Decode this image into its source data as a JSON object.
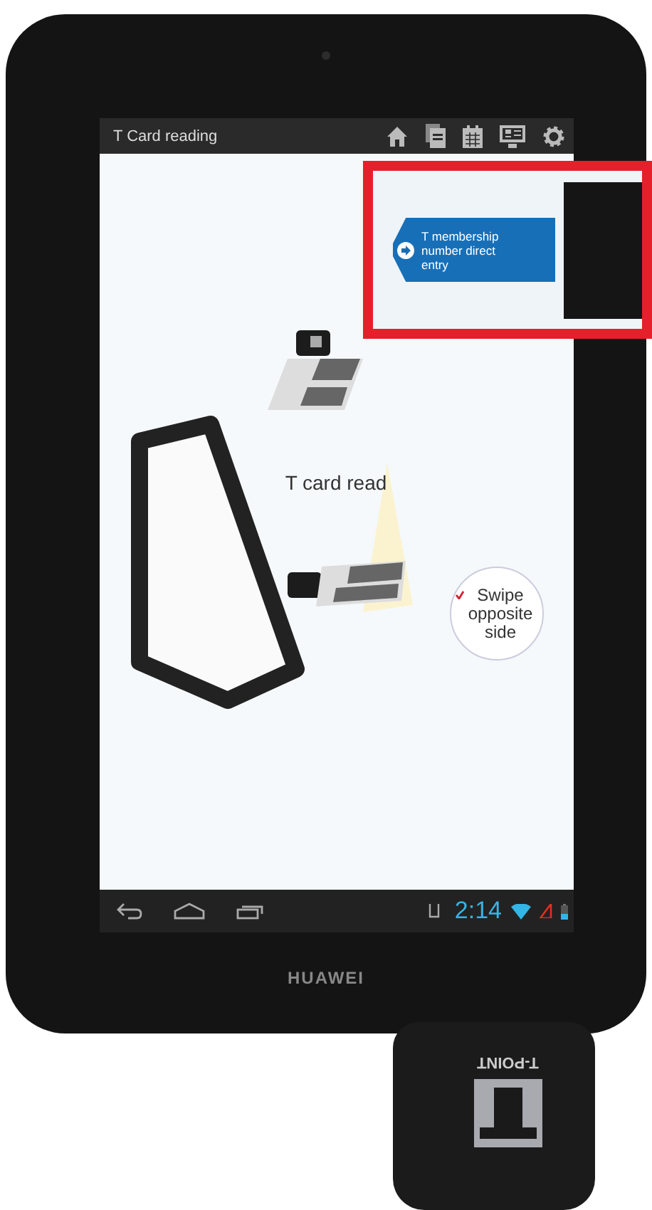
{
  "action_bar": {
    "title": "T Card reading"
  },
  "banner": {
    "label": "T membership number direct entry"
  },
  "main": {
    "caption": "T card read",
    "bubble": "Swipe opposite side"
  },
  "status_bar": {
    "time": "2:14"
  },
  "device": {
    "brand": "HUAWEI",
    "reader_label": "T-POINT"
  }
}
